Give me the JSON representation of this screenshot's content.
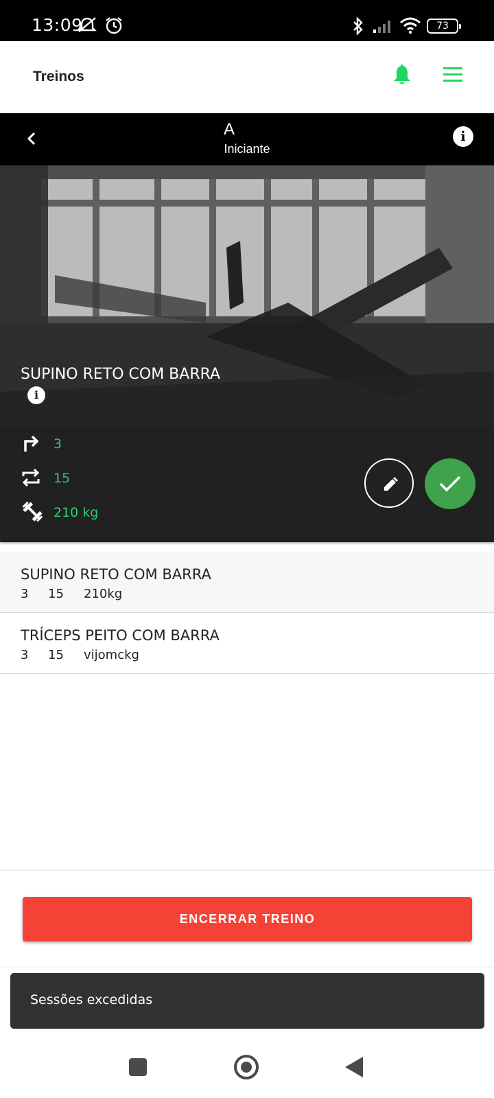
{
  "status_bar": {
    "time": "13:09",
    "battery": "73"
  },
  "app_bar": {
    "title": "Treinos"
  },
  "workout": {
    "name": "A",
    "level": "Iniciante"
  },
  "current_exercise": {
    "name": "SUPINO RETO COM BARRA",
    "sets": "3",
    "reps": "15",
    "weight": "210 kg"
  },
  "exercises": [
    {
      "name": "SUPINO RETO COM BARRA",
      "sets": "3",
      "reps": "15",
      "weight": "210kg"
    },
    {
      "name": "TRÍCEPS PEITO COM BARRA",
      "sets": "3",
      "reps": "15",
      "weight": "vijomckg"
    }
  ],
  "end_button": {
    "label": "ENCERRAR TREINO"
  },
  "snackbar": {
    "message": "Sessões excedidas"
  },
  "colors": {
    "accent": "#2ecc71",
    "danger": "#f44336",
    "success": "#3fa34d",
    "header": "#000000",
    "panel": "#212121"
  },
  "icons": [
    "bell-icon",
    "menu-icon",
    "back-arrow-icon",
    "info-icon",
    "sets-icon",
    "reps-icon",
    "weight-icon",
    "edit-icon",
    "check-icon"
  ]
}
